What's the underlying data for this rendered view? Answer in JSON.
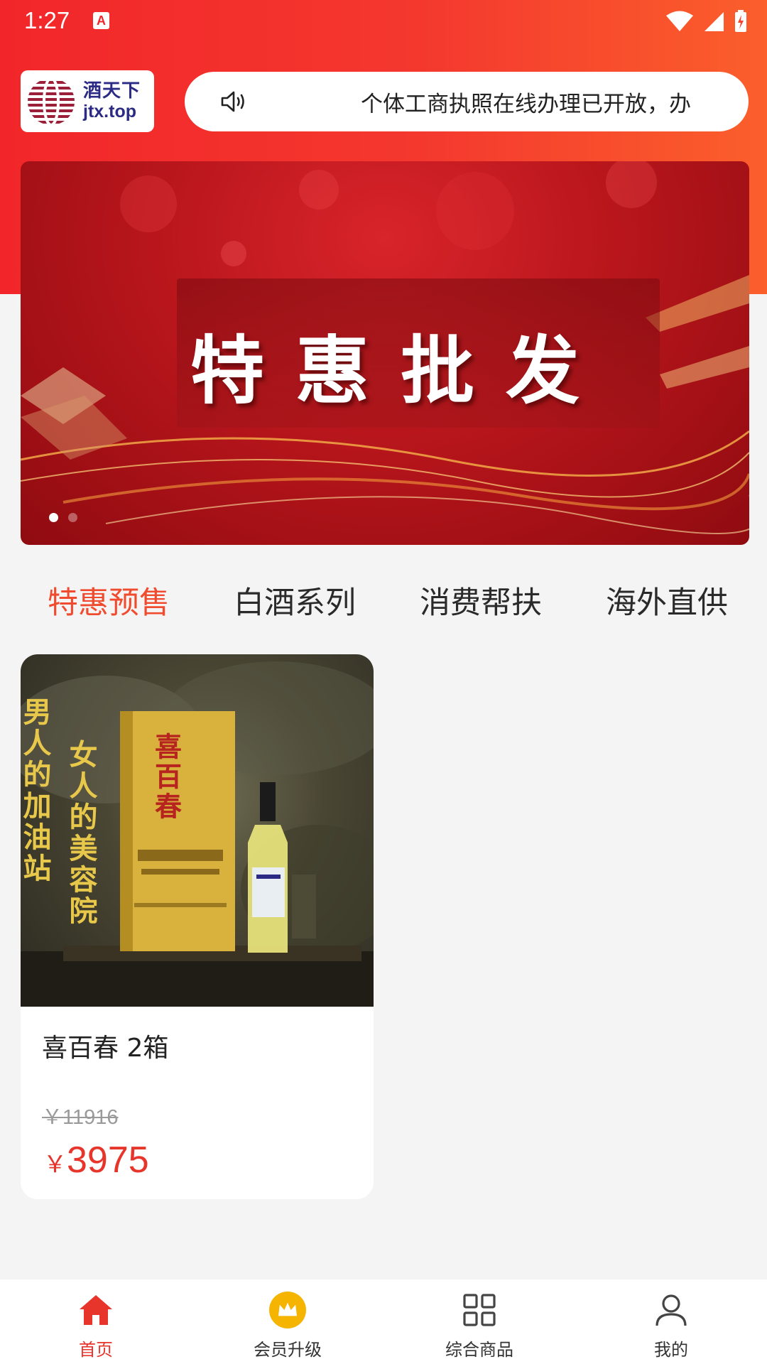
{
  "status_bar": {
    "time": "1:27",
    "notification_glyph": "A",
    "icons": [
      "wifi-icon",
      "signal-icon",
      "battery-charging-icon"
    ]
  },
  "header": {
    "logo": {
      "name_cn": "酒天下",
      "domain": "jtx.top"
    },
    "notice": {
      "icon": "speaker-icon",
      "text": "个体工商执照在线办理已开放，办"
    }
  },
  "banner": {
    "title": "特惠批发",
    "slide_count": 2,
    "active_slide": 0
  },
  "categories": {
    "tabs": [
      {
        "label": "特惠预售",
        "active": true
      },
      {
        "label": "白酒系列",
        "active": false
      },
      {
        "label": "消费帮扶",
        "active": false
      },
      {
        "label": "海外直供",
        "active": false
      }
    ]
  },
  "products": [
    {
      "title": "喜百春 2箱",
      "original_price": "￥11916",
      "currency": "￥",
      "price": "3975",
      "image": {
        "slogan_left": "男人的加油站",
        "slogan_right": "女人的美容院",
        "box_brand": "喜百春"
      }
    }
  ],
  "bottom_nav": {
    "items": [
      {
        "label": "首页",
        "icon": "home-icon",
        "active": true
      },
      {
        "label": "会员升级",
        "icon": "crown-icon",
        "active": false
      },
      {
        "label": "综合商品",
        "icon": "grid-icon",
        "active": false
      },
      {
        "label": "我的",
        "icon": "user-icon",
        "active": false
      }
    ]
  },
  "colors": {
    "header_red": "#f2262a",
    "header_orange": "#fb5f2c",
    "accent": "#e8352c",
    "tab_active": "#f04b2f",
    "crown_gold": "#f5b400",
    "logo_navy": "#2b2a85",
    "page_bg": "#f4f4f4"
  }
}
